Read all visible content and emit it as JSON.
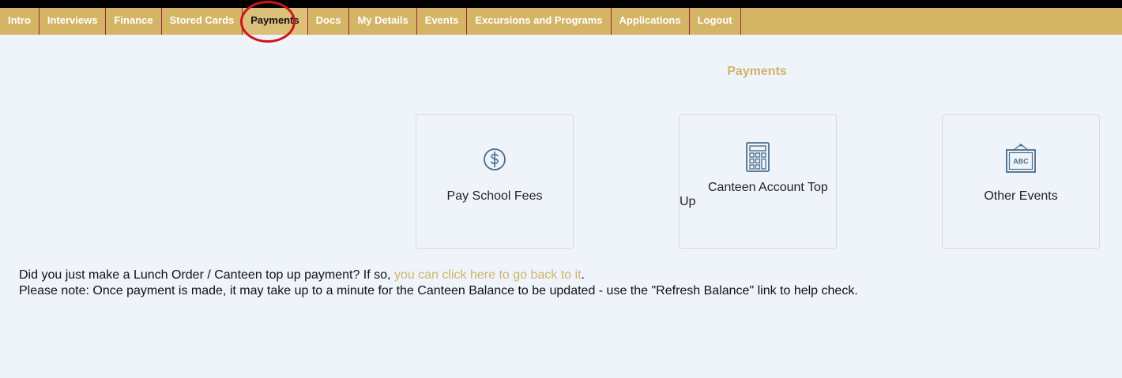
{
  "nav": {
    "items": [
      {
        "label": "Intro"
      },
      {
        "label": "Interviews"
      },
      {
        "label": "Finance"
      },
      {
        "label": "Stored Cards"
      },
      {
        "label": "Payments"
      },
      {
        "label": "Docs"
      },
      {
        "label": "My Details"
      },
      {
        "label": "Events"
      },
      {
        "label": "Excursions and Programs"
      },
      {
        "label": "Applications"
      },
      {
        "label": "Logout"
      }
    ],
    "active": "Payments"
  },
  "page": {
    "title": "Payments"
  },
  "cards": {
    "fees": {
      "label": "Pay School Fees",
      "icon": "dollar-circle-icon"
    },
    "canteen": {
      "label_line1": "Canteen Account Top",
      "label_line2": "Up",
      "icon": "calculator-icon"
    },
    "events": {
      "label": "Other Events",
      "icon": "abc-board-icon",
      "icon_text": "ABC"
    }
  },
  "notes": {
    "line1_prefix": "Did you just make a Lunch Order / Canteen top up payment? If so, ",
    "line1_link": "you can click here to go back to it",
    "line1_suffix": ".",
    "line2": "Please note: Once payment is made, it may take up to a minute for the Canteen Balance to be updated - use the \"Refresh Balance\" link to help check."
  },
  "colors": {
    "nav_bg": "#d4b566",
    "accent": "#d0b36a",
    "page_bg": "#eff4fa",
    "icon": "#4a6d8c",
    "highlight_circle": "#d0131c"
  }
}
